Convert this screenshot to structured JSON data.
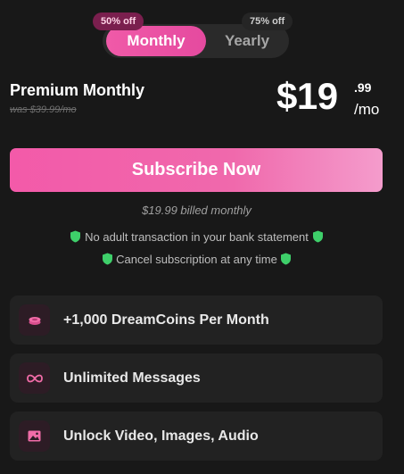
{
  "billing_toggle": {
    "options": [
      {
        "label": "Monthly",
        "badge": "50% off",
        "selected": true
      },
      {
        "label": "Yearly",
        "badge": "75% off",
        "selected": false
      }
    ]
  },
  "plan": {
    "name": "Premium Monthly",
    "was_price": "was $39.99/mo",
    "price_whole": "$19",
    "price_cents": ".99",
    "price_period": "/mo"
  },
  "subscribe_button_label": "Subscribe Now",
  "billing_note": "$19.99 billed monthly",
  "assurances": [
    "No adult transaction in your bank statement",
    "Cancel subscription at any time"
  ],
  "features": [
    {
      "label": "+1,000 DreamCoins Per Month",
      "icon": "coins-icon"
    },
    {
      "label": "Unlimited Messages",
      "icon": "infinity-icon"
    },
    {
      "label": "Unlock Video, Images, Audio",
      "icon": "image-icon"
    }
  ],
  "colors": {
    "accent": "#f05aa8",
    "background": "#181818",
    "card": "#222222",
    "shield": "#3ecf6a"
  }
}
